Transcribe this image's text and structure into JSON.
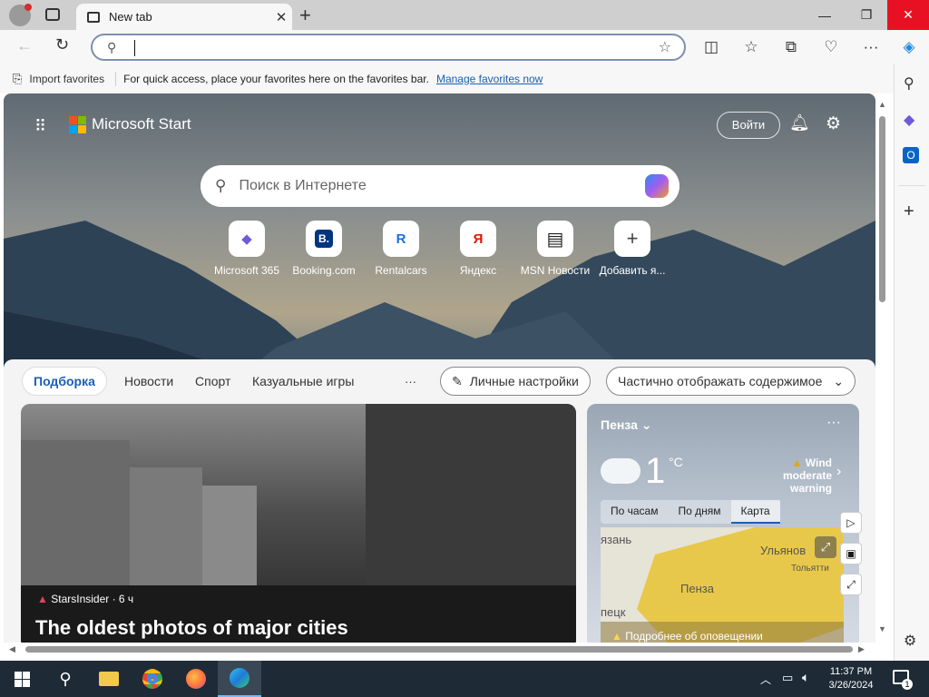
{
  "browser": {
    "tab_title": "New tab",
    "address_value": ""
  },
  "favorites_bar": {
    "import_label": "Import favorites",
    "message": "For quick access, place your favorites here on the favorites bar.",
    "manage_link": "Manage favorites now"
  },
  "msstart": {
    "brand": "Microsoft Start",
    "signin_label": "Войти",
    "search_placeholder": "Поиск в Интернете",
    "tiles": [
      {
        "label": "Microsoft 365",
        "glyph": "◆"
      },
      {
        "label": "Booking.com",
        "glyph": "B."
      },
      {
        "label": "Rentalcars",
        "glyph": "R"
      },
      {
        "label": "Яндекс",
        "glyph": "Я"
      },
      {
        "label": "MSN Новости",
        "glyph": "▤"
      },
      {
        "label": "Добавить я...",
        "glyph": "+"
      }
    ]
  },
  "feed_nav": {
    "tabs": [
      "Подборка",
      "Новости",
      "Спорт",
      "Казуальные игры"
    ],
    "more": "···",
    "personalize": "Личные настройки",
    "content_mode": "Частично отображать содержимое"
  },
  "hero": {
    "source": "StarsInsider · 6 ч",
    "title": "The oldest photos of major cities"
  },
  "weather": {
    "city": "Пенза",
    "temp": "1",
    "unit": "°C",
    "alert_title": "Wind",
    "alert_sub": "moderate warning",
    "tabs": [
      "По часам",
      "По дням",
      "Карта"
    ],
    "map_labels": [
      "язань",
      "Ульянов",
      "Тольятти",
      "Пенза",
      "пецк"
    ],
    "alert_more": "Подробнее об оповещении"
  },
  "taskbar": {
    "time": "11:37 PM",
    "date": "3/26/2024",
    "notif_count": "1"
  },
  "colors": {
    "accent": "#1a5fb4",
    "warning": "#e0a800",
    "taskbar": "#1e2a36"
  }
}
